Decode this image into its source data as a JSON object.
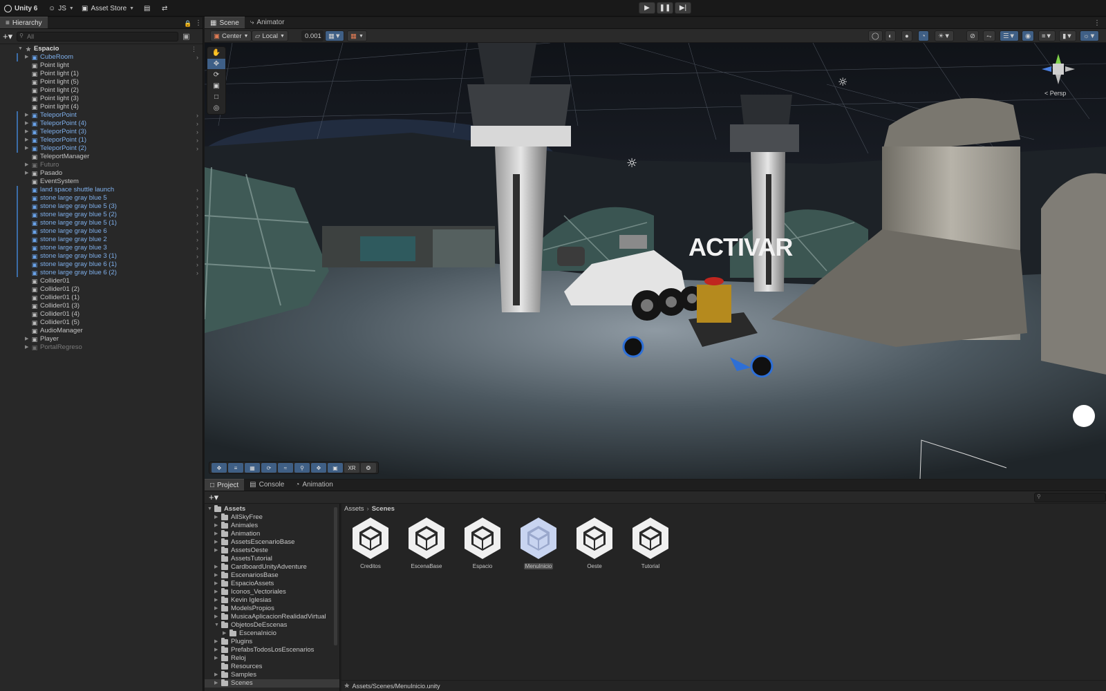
{
  "topbar": {
    "app_title": "Unity 6",
    "account": "JS",
    "asset_store": "Asset Store"
  },
  "hierarchy": {
    "tab": "Hierarchy",
    "search_placeholder": "All",
    "scene_root": "Espacio",
    "items": [
      {
        "label": "CubeRoom",
        "type": "prefab",
        "expandable": true
      },
      {
        "label": "Point light",
        "type": "object"
      },
      {
        "label": "Point light (1)",
        "type": "object"
      },
      {
        "label": "Point light (5)",
        "type": "object"
      },
      {
        "label": "Point light (2)",
        "type": "object"
      },
      {
        "label": "Point light (3)",
        "type": "object"
      },
      {
        "label": "Point light (4)",
        "type": "object"
      },
      {
        "label": "TeleporPoint",
        "type": "prefab",
        "expandable": true
      },
      {
        "label": "TeleporPoint (4)",
        "type": "prefab",
        "expandable": true
      },
      {
        "label": "TeleporPoint (3)",
        "type": "prefab",
        "expandable": true
      },
      {
        "label": "TeleporPoint (1)",
        "type": "prefab",
        "expandable": true
      },
      {
        "label": "TeleporPoint (2)",
        "type": "prefab",
        "expandable": true
      },
      {
        "label": "TeleportManager",
        "type": "object"
      },
      {
        "label": "Futuro",
        "type": "disabled",
        "expandable": true
      },
      {
        "label": "Pasado",
        "type": "object",
        "expandable": true
      },
      {
        "label": "EventSystem",
        "type": "object"
      },
      {
        "label": "land space shuttle launch",
        "type": "prefab"
      },
      {
        "label": "stone large gray blue 5",
        "type": "prefab"
      },
      {
        "label": "stone large gray blue 5 (3)",
        "type": "prefab"
      },
      {
        "label": "stone large gray blue 5 (2)",
        "type": "prefab"
      },
      {
        "label": "stone large gray blue 5 (1)",
        "type": "prefab"
      },
      {
        "label": "stone large gray blue 6",
        "type": "prefab"
      },
      {
        "label": "stone large gray blue 2",
        "type": "prefab"
      },
      {
        "label": "stone large gray blue 3",
        "type": "prefab"
      },
      {
        "label": "stone large gray blue 3 (1)",
        "type": "prefab"
      },
      {
        "label": "stone large gray blue 6 (1)",
        "type": "prefab"
      },
      {
        "label": "stone large gray blue 6 (2)",
        "type": "prefab"
      },
      {
        "label": "Collider01",
        "type": "object"
      },
      {
        "label": "Collider01 (2)",
        "type": "object"
      },
      {
        "label": "Collider01 (1)",
        "type": "object"
      },
      {
        "label": "Collider01 (3)",
        "type": "object"
      },
      {
        "label": "Collider01 (4)",
        "type": "object"
      },
      {
        "label": "Collider01 (5)",
        "type": "object"
      },
      {
        "label": "AudioManager",
        "type": "object"
      },
      {
        "label": "Player",
        "type": "object",
        "expandable": true
      },
      {
        "label": "PortalRegreso",
        "type": "disabled",
        "expandable": true
      }
    ]
  },
  "scene": {
    "tabs": [
      "Scene",
      "Animator"
    ],
    "pivot": "Center",
    "space": "Local",
    "snap_value": "0.001",
    "persp_label": "< Persp",
    "overlay_text": "ACTIVAR",
    "xr_label": "XR"
  },
  "project": {
    "tabs": [
      "Project",
      "Console",
      "Animation"
    ],
    "breadcrumb": [
      "Assets",
      "Scenes"
    ],
    "root": "Assets",
    "folders": [
      {
        "label": "AllSkyFree",
        "expanded": false,
        "depth": 1
      },
      {
        "label": "Animales",
        "expanded": false,
        "depth": 1
      },
      {
        "label": "Animation",
        "expanded": false,
        "depth": 1
      },
      {
        "label": "AssetsEscenarioBase",
        "expanded": false,
        "depth": 1
      },
      {
        "label": "AssetsOeste",
        "expanded": false,
        "depth": 1
      },
      {
        "label": "AssetsTutorial",
        "expanded": false,
        "depth": 1,
        "noarrow": true
      },
      {
        "label": "CardboardUnityAdventure",
        "expanded": false,
        "depth": 1
      },
      {
        "label": "EscenariosBase",
        "expanded": false,
        "depth": 1
      },
      {
        "label": "EspacioAssets",
        "expanded": false,
        "depth": 1
      },
      {
        "label": "Iconos_Vectoriales",
        "expanded": false,
        "depth": 1
      },
      {
        "label": "Kevin Iglesias",
        "expanded": false,
        "depth": 1
      },
      {
        "label": "ModelsPropios",
        "expanded": false,
        "depth": 1
      },
      {
        "label": "MusicaAplicacionRealidadVirtual",
        "expanded": false,
        "depth": 1
      },
      {
        "label": "ObjetosDeEscenas",
        "expanded": true,
        "depth": 1
      },
      {
        "label": "EscenaInicio",
        "expanded": false,
        "depth": 2
      },
      {
        "label": "Plugins",
        "expanded": false,
        "depth": 1
      },
      {
        "label": "PrefabsTodosLosEscenarios",
        "expanded": false,
        "depth": 1
      },
      {
        "label": "Reloj",
        "expanded": false,
        "depth": 1
      },
      {
        "label": "Resources",
        "expanded": false,
        "depth": 1,
        "noarrow": true
      },
      {
        "label": "Samples",
        "expanded": false,
        "depth": 1
      },
      {
        "label": "Scenes",
        "expanded": false,
        "depth": 1,
        "selected": true
      }
    ],
    "assets": [
      {
        "label": "Creditos",
        "selected": false
      },
      {
        "label": "EscenaBase",
        "selected": false
      },
      {
        "label": "Espacio",
        "selected": false
      },
      {
        "label": "MenuInicio",
        "selected": true
      },
      {
        "label": "Oeste",
        "selected": false
      },
      {
        "label": "Tutorial",
        "selected": false
      }
    ],
    "status_path": "Assets/Scenes/MenuInicio.unity"
  }
}
